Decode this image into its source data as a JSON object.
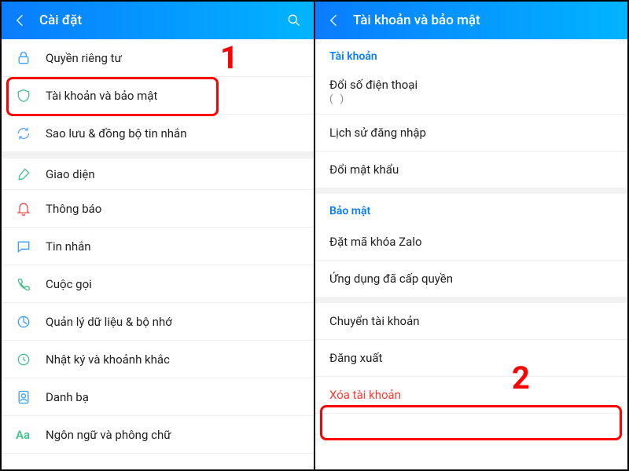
{
  "left": {
    "header_title": "Cài đặt",
    "items": [
      {
        "label": "Quyền riêng tư"
      },
      {
        "label": "Tài khoản và bảo mật"
      },
      {
        "label": "Sao lưu & đồng bộ tin nhắn"
      },
      {
        "label": "Giao diện"
      },
      {
        "label": "Thông báo"
      },
      {
        "label": "Tin nhắn"
      },
      {
        "label": "Cuộc gọi"
      },
      {
        "label": "Quản lý dữ liệu & bộ nhớ"
      },
      {
        "label": "Nhật ký và khoảnh khắc"
      },
      {
        "label": "Danh bạ"
      },
      {
        "label": "Ngôn ngữ và phông chữ"
      }
    ],
    "callout": "1"
  },
  "right": {
    "header_title": "Tài khoản và bảo mật",
    "section_account": "Tài khoản",
    "items_account": [
      {
        "label": "Đổi số điện thoại",
        "sub": "(           )"
      },
      {
        "label": "Lịch sử đăng nhập"
      },
      {
        "label": "Đổi mật khẩu"
      }
    ],
    "section_security": "Bảo mật",
    "items_security": [
      {
        "label": "Đặt mã khóa Zalo"
      },
      {
        "label": "Ứng dụng đã cấp quyền"
      }
    ],
    "items_other": [
      {
        "label": "Chuyển tài khoản"
      },
      {
        "label": "Đăng xuất"
      },
      {
        "label": "Xóa tài khoản",
        "danger": true
      }
    ],
    "callout": "2"
  }
}
